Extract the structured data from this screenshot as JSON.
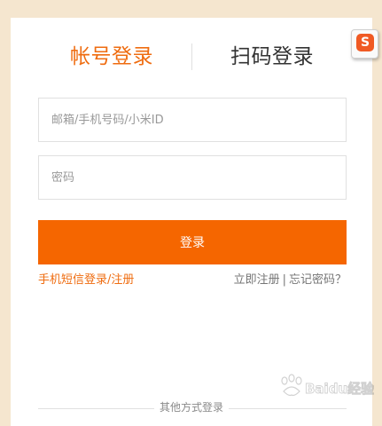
{
  "tabs": {
    "account_login": "帐号登录",
    "qr_login": "扫码登录"
  },
  "form": {
    "account_placeholder": "邮箱/手机号码/小米ID",
    "password_placeholder": "密码",
    "login_button": "登录"
  },
  "links": {
    "sms_login_register": "手机短信登录/注册",
    "register_now": "立即注册",
    "separator": "|",
    "forgot_password": "忘记密码？"
  },
  "footer": {
    "other_methods": "其他方式登录"
  },
  "overlay": {
    "sogou_icon_letter": "S",
    "watermark_text": "Baidu经验"
  },
  "colors": {
    "accent": "#f56600",
    "accent_text": "#ef6c10",
    "background": "#f5e6cf"
  }
}
